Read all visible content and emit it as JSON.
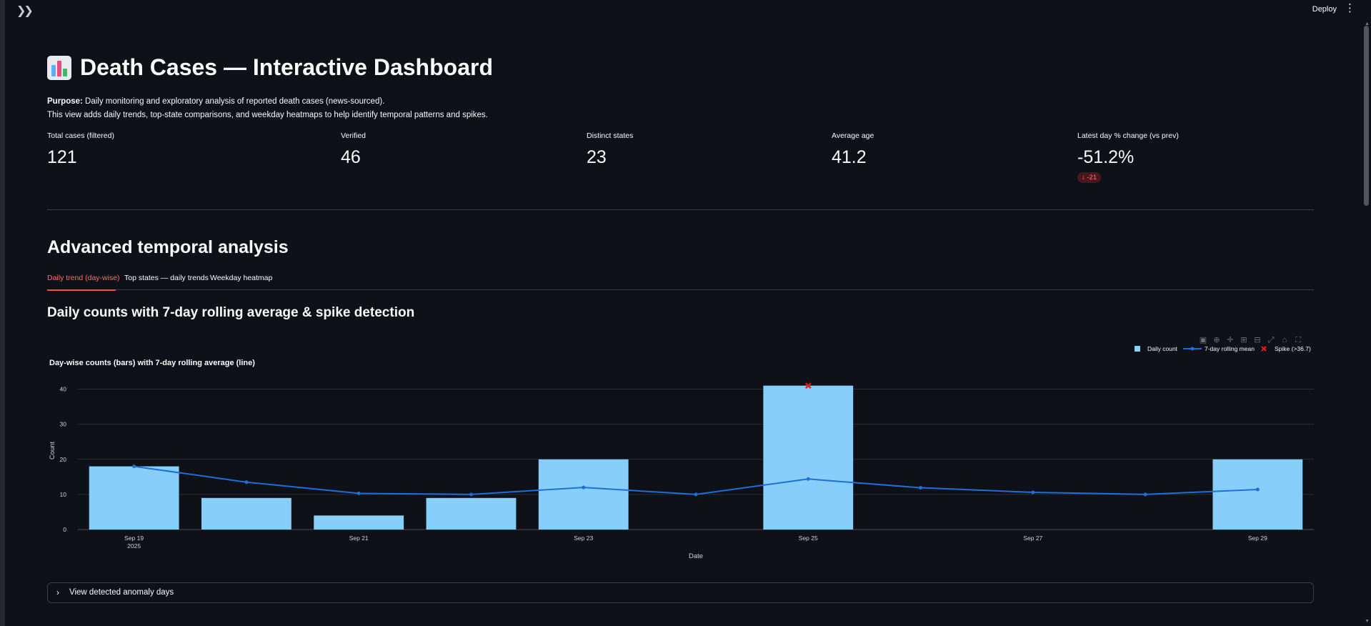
{
  "header": {
    "expand_icon": "double-chevron-right-icon",
    "deploy_label": "Deploy",
    "menu_icon": "vertical-dots-icon"
  },
  "page": {
    "title_icon": "bar-chart-icon",
    "title": "Death Cases — Interactive Dashboard",
    "purpose_label": "Purpose:",
    "purpose_text": "Daily monitoring and exploratory analysis of reported death cases (news-sourced).",
    "description": "This view adds daily trends, top-state comparisons, and weekday heatmaps to help identify temporal patterns and spikes."
  },
  "metrics": [
    {
      "label": "Total cases (filtered)",
      "value": "121"
    },
    {
      "label": "Verified",
      "value": "46"
    },
    {
      "label": "Distinct states",
      "value": "23"
    },
    {
      "label": "Average age",
      "value": "41.2"
    },
    {
      "label": "Latest day % change (vs prev)",
      "value": "-51.2%",
      "delta": "-21",
      "delta_icon": "arrow-down-icon"
    }
  ],
  "section": {
    "title": "Advanced temporal analysis",
    "tabs": [
      "Daily trend (day-wise)",
      "Top states — daily trends",
      "Weekday heatmap"
    ],
    "active_tab": 0,
    "subheader": "Daily counts with 7-day rolling average & spike detection"
  },
  "modebar": [
    "camera-icon",
    "zoom-icon",
    "pan-icon",
    "zoom-in-icon",
    "zoom-out-icon",
    "autoscale-icon",
    "home-icon",
    "fullscreen-icon"
  ],
  "chart_data": {
    "type": "bar",
    "title": "Day-wise counts (bars) with 7-day rolling average (line)",
    "xlabel": "Date",
    "ylabel": "Count",
    "ylim": [
      0,
      45
    ],
    "yticks": [
      0,
      10,
      20,
      30,
      40
    ],
    "x_tick_labels": [
      "Sep 19",
      "Sep 21",
      "Sep 23",
      "Sep 25",
      "Sep 27",
      "Sep 29"
    ],
    "x_year_label": "2025",
    "legend_position": "top-right",
    "dates": [
      "2025-09-19",
      "2025-09-20",
      "2025-09-21",
      "2025-09-22",
      "2025-09-23",
      "2025-09-24",
      "2025-09-25",
      "2025-09-26",
      "2025-09-27",
      "2025-09-28",
      "2025-09-29"
    ],
    "series": [
      {
        "name": "Daily count",
        "kind": "bar",
        "color": "#87cefa",
        "values": [
          18,
          9,
          4,
          9,
          20,
          0,
          41,
          0,
          0,
          0,
          20
        ]
      },
      {
        "name": "7-day rolling mean",
        "kind": "line",
        "color": "#1e6fd9",
        "values": [
          18,
          13.5,
          10.3,
          10,
          12,
          10,
          14.4,
          11.9,
          10.6,
          10,
          11.4
        ]
      },
      {
        "name": "Spike (>36.7)",
        "kind": "marker",
        "color": "#e5191e",
        "points": [
          {
            "date": "2025-09-25",
            "value": 41
          }
        ]
      }
    ]
  },
  "expander": {
    "icon": "chevron-right-icon",
    "label": "View detected anomaly days"
  }
}
